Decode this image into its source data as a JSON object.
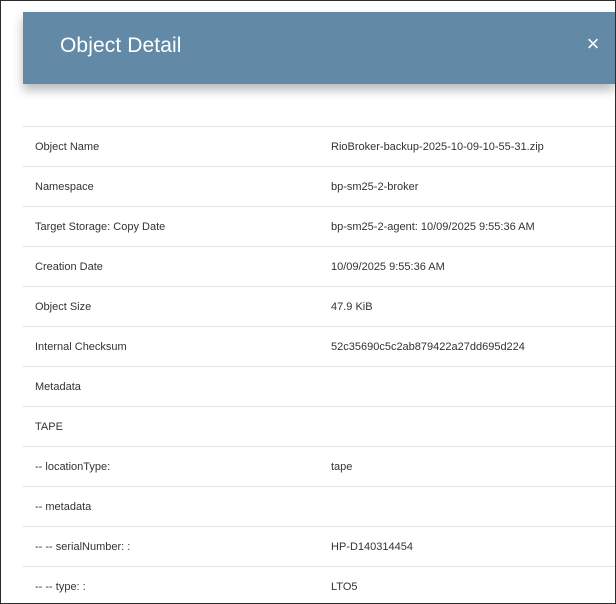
{
  "modal": {
    "title": "Object Detail",
    "close_glyph": "×"
  },
  "rows": [
    {
      "label": "Object Name",
      "value": "RioBroker-backup-2025-10-09-10-55-31.zip"
    },
    {
      "label": "Namespace",
      "value": "bp-sm25-2-broker"
    },
    {
      "label": "Target Storage: Copy Date",
      "value": "bp-sm25-2-agent: 10/09/2025 9:55:36 AM"
    },
    {
      "label": "Creation Date",
      "value": "10/09/2025 9:55:36 AM"
    },
    {
      "label": "Object Size",
      "value": "47.9 KiB"
    },
    {
      "label": "Internal Checksum",
      "value": "52c35690c5c2ab879422a27dd695d224"
    },
    {
      "label": "Metadata",
      "value": ""
    },
    {
      "label": "TAPE",
      "value": ""
    },
    {
      "label": "-- locationType:",
      "value": "tape"
    },
    {
      "label": "-- metadata",
      "value": ""
    },
    {
      "label": "-- -- serialNumber: :",
      "value": "HP-D140314454"
    },
    {
      "label": "-- -- type: :",
      "value": "LTO5"
    }
  ],
  "colors": {
    "header_bg": "#628aa6",
    "header_text": "#ffffff",
    "row_border": "#e3e3e3",
    "text": "#333333"
  }
}
